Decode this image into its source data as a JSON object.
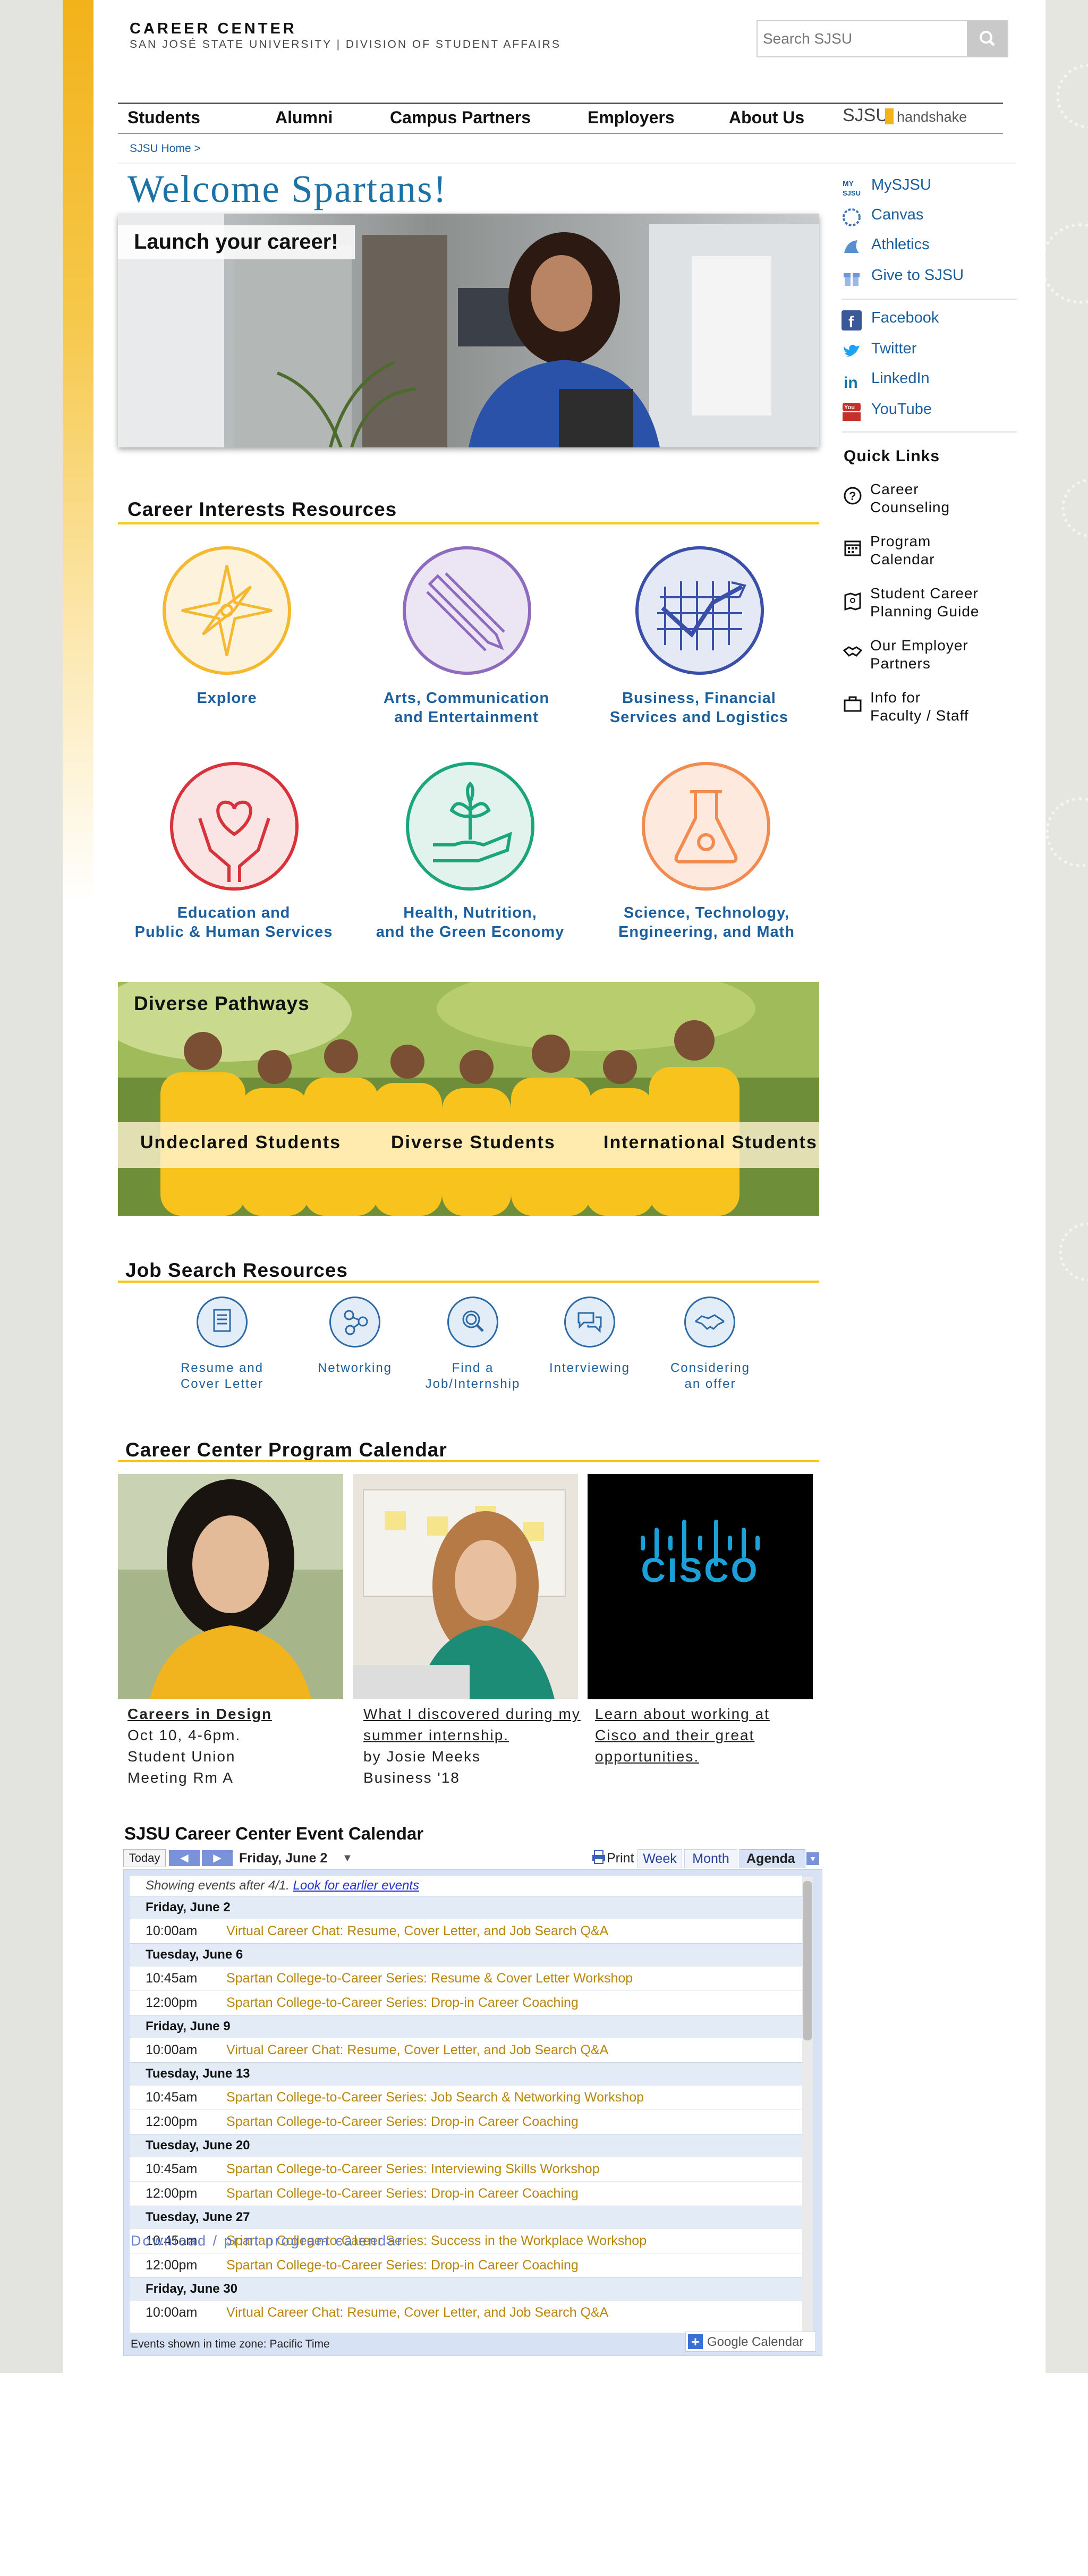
{
  "header": {
    "title": "CAREER CENTER",
    "subtitle": "SAN JOSÉ STATE UNIVERSITY | DIVISION OF STUDENT AFFAIRS",
    "search_placeholder": "Search SJSU"
  },
  "nav": {
    "items": [
      "Students",
      "Alumni",
      "Campus Partners",
      "Employers",
      "About Us"
    ],
    "logo_sjsu": "SJSU",
    "logo_handshake": "handshake"
  },
  "breadcrumb": "SJSU Home >",
  "hero": {
    "heading": "Welcome Spartans!",
    "tag": "Launch your career!"
  },
  "career_interests": {
    "title": "Career Interests Resources",
    "items": [
      {
        "label": "Explore",
        "color": "#f5b82e"
      },
      {
        "label": "Arts, Communication\nand Entertainment",
        "color": "#8e6bbf"
      },
      {
        "label": "Business, Financial\nServices and Logistics",
        "color": "#3a4fa8"
      },
      {
        "label": "Education and\nPublic & Human Services",
        "color": "#d9323b"
      },
      {
        "label": "Health, Nutrition,\nand the Green Economy",
        "color": "#1aa57a"
      },
      {
        "label": "Science, Technology,\nEngineering, and Math",
        "color": "#f28b50"
      }
    ]
  },
  "pathways": {
    "title": "Diverse Pathways",
    "items": [
      "Undeclared Students",
      "Diverse Students",
      "International Students"
    ]
  },
  "job_search": {
    "title": "Job Search Resources",
    "items": [
      {
        "label": "Resume and\nCover Letter",
        "icon": "document-icon"
      },
      {
        "label": "Networking",
        "icon": "network-icon"
      },
      {
        "label": "Find a\nJob/Internship",
        "icon": "magnifier-icon"
      },
      {
        "label": "Interviewing",
        "icon": "chat-icon"
      },
      {
        "label": "Considering\nan offer",
        "icon": "handshake-icon"
      }
    ]
  },
  "program_calendar": {
    "title": "Career Center Program Calendar",
    "cards": [
      {
        "link": "Careers in Design",
        "lines": [
          "Oct 10, 4-6pm.",
          "Student Union",
          "Meeting Rm A"
        ]
      },
      {
        "link": "What I discovered during my summer internship.",
        "lines": [
          "by Josie Meeks",
          "Business '18"
        ]
      },
      {
        "link": "Learn about working at Cisco and their great opportunities.",
        "lines": []
      }
    ],
    "cisco_logo": "CISCO"
  },
  "event_calendar": {
    "title": "SJSU Career Center Event Calendar",
    "today_label": "Today",
    "current_date": "Friday, June 2",
    "print_label": "Print",
    "views": [
      "Week",
      "Month",
      "Agenda"
    ],
    "notice": "Showing events after 4/1.",
    "notice_link": "Look for earlier events",
    "days": [
      {
        "date": "Friday, June 2",
        "events": [
          {
            "time": "10:00am",
            "title": "Virtual Career Chat: Resume, Cover Letter, and Job Search Q&A"
          }
        ]
      },
      {
        "date": "Tuesday, June 6",
        "events": [
          {
            "time": "10:45am",
            "title": "Spartan College-to-Career Series: Resume & Cover Letter Workshop"
          },
          {
            "time": "12:00pm",
            "title": "Spartan College-to-Career Series: Drop-in Career Coaching"
          }
        ]
      },
      {
        "date": "Friday, June 9",
        "events": [
          {
            "time": "10:00am",
            "title": "Virtual Career Chat: Resume, Cover Letter, and Job Search Q&A"
          }
        ]
      },
      {
        "date": "Tuesday, June 13",
        "events": [
          {
            "time": "10:45am",
            "title": "Spartan College-to-Career Series: Job Search & Networking Workshop"
          },
          {
            "time": "12:00pm",
            "title": "Spartan College-to-Career Series: Drop-in Career Coaching"
          }
        ]
      },
      {
        "date": "Tuesday, June 20",
        "events": [
          {
            "time": "10:45am",
            "title": "Spartan College-to-Career Series: Interviewing Skills Workshop"
          },
          {
            "time": "12:00pm",
            "title": "Spartan College-to-Career Series: Drop-in Career Coaching"
          }
        ]
      },
      {
        "date": "Tuesday, June 27",
        "events": [
          {
            "time": "10:45am",
            "title": "Spartan College-to-Career Series: Success in the Workplace Workshop"
          },
          {
            "time": "12:00pm",
            "title": "Spartan College-to-Career Series: Drop-in Career Coaching"
          }
        ]
      },
      {
        "date": "Friday, June 30",
        "events": [
          {
            "time": "10:00am",
            "title": "Virtual Career Chat: Resume, Cover Letter, and Job Search Q&A"
          }
        ]
      }
    ],
    "download_link": "Download / print program calendar",
    "footer": "Events shown in time zone: Pacific Time",
    "brand": "Google Calendar"
  },
  "sidebar": {
    "links": [
      {
        "label": "MySJSU",
        "icon": "mysjsu-icon"
      },
      {
        "label": "Canvas",
        "icon": "canvas-icon"
      },
      {
        "label": "Athletics",
        "icon": "athletics-icon"
      },
      {
        "label": "Give to SJSU",
        "icon": "gift-icon"
      }
    ],
    "social": [
      {
        "label": "Facebook",
        "icon": "facebook-icon"
      },
      {
        "label": "Twitter",
        "icon": "twitter-icon"
      },
      {
        "label": "LinkedIn",
        "icon": "linkedin-icon"
      },
      {
        "label": "YouTube",
        "icon": "youtube-icon"
      }
    ],
    "quick_links_title": "Quick Links",
    "quick_links": [
      {
        "label": "Career\nCounseling",
        "icon": "question-icon"
      },
      {
        "label": "Program\nCalendar",
        "icon": "calendar-icon"
      },
      {
        "label": "Student Career\nPlanning Guide",
        "icon": "guide-icon"
      },
      {
        "label": "Our Employer\nPartners",
        "icon": "handshake-icon"
      },
      {
        "label": "Info for\nFaculty / Staff",
        "icon": "briefcase-icon"
      }
    ]
  }
}
